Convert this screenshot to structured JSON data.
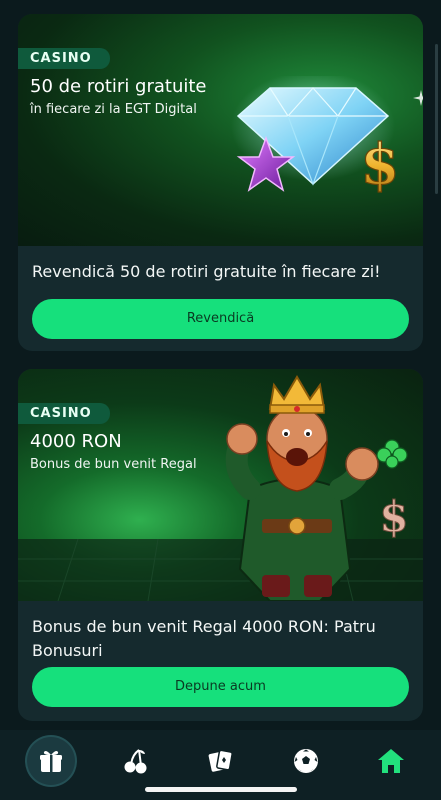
{
  "cards": [
    {
      "tag": "CASINO",
      "title": "50 de rotiri gratuite",
      "subtitle": "în fiecare zi la EGT Digital",
      "description": "Revendică 50 de rotiri gratuite în fiecare zi!",
      "cta_label": "Revendică",
      "art": [
        "diamond",
        "star",
        "dollar-sign"
      ]
    },
    {
      "tag": "CASINO",
      "title": "4000 RON",
      "subtitle": "Bonus de bun venit Regal",
      "description": "Bonus de bun venit Regal 4000 RON: Patru Bonusuri",
      "cta_label": "Depune acum",
      "art": [
        "king-character",
        "clover",
        "dollar-sign"
      ]
    }
  ],
  "nav": {
    "items": [
      {
        "name": "gift-icon",
        "active": true
      },
      {
        "name": "cherries-icon",
        "active": false
      },
      {
        "name": "cards-icon",
        "active": false
      },
      {
        "name": "soccer-ball-icon",
        "active": false
      },
      {
        "name": "home-icon",
        "active": false
      }
    ]
  },
  "colors": {
    "accent": "#16e07c",
    "background": "#0b1a1d",
    "card": "#152a2e",
    "tag": "#0f5a3c",
    "home_icon": "#22e07d"
  }
}
